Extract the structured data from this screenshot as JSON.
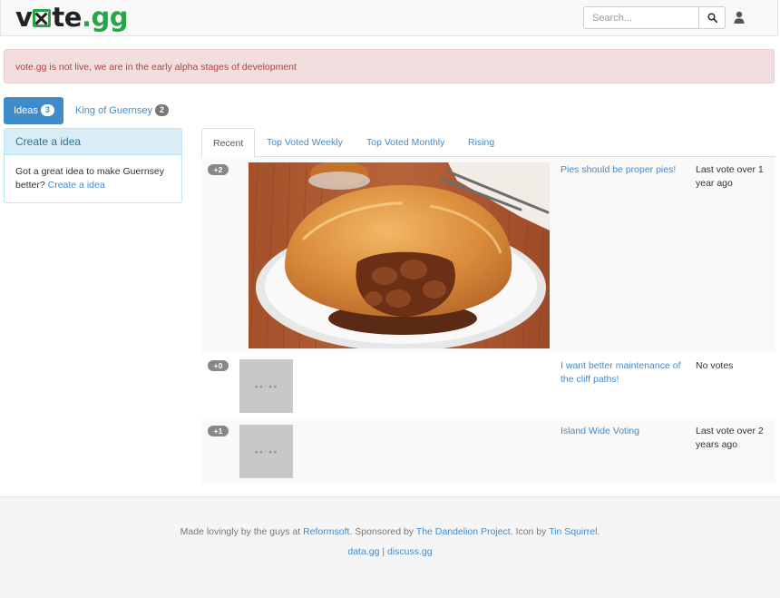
{
  "brand": {
    "part1": "v",
    "part2": "te",
    "dot": ".",
    "part3": "gg"
  },
  "search": {
    "placeholder": "Search..."
  },
  "icons": {
    "search": "search-icon",
    "user": "user-icon"
  },
  "colors": {
    "primary": "#428bca",
    "brand_green": "#2aa44a",
    "alert_bg": "#f2dede",
    "alert_text": "#a94442"
  },
  "alert": {
    "text": "vote.gg is not live, we are in the early alpha stages of development"
  },
  "pills": [
    {
      "label": "Ideas",
      "count": "3",
      "active": true
    },
    {
      "label": "King of Guernsey",
      "count": "2",
      "active": false
    }
  ],
  "panel": {
    "heading": "Create a idea",
    "body": "Got a great idea to make Guernsey better?",
    "link": "Create a idea"
  },
  "tabs": [
    "Recent",
    "Top Voted Weekly",
    "Top Voted Monthly",
    "Rising"
  ],
  "ideas": [
    {
      "votes": "+2",
      "title": "Pies should be proper pies!",
      "last_vote": "Last vote over 1 year ago"
    },
    {
      "votes": "+0",
      "title": "I want better maintenance of the cliff paths!",
      "last_vote": "No votes"
    },
    {
      "votes": "+1",
      "title": "Island Wide Voting",
      "last_vote": "Last vote over 2 years ago"
    }
  ],
  "footer": {
    "made_by": "Made lovingly by the guys at",
    "reformsoft": "Reformsoft",
    "sponsored": ". Sponsored by",
    "dandelion": "The Dandelion Project",
    "icon_by": ". Icon by",
    "tin": "Tin Squirrel",
    "end": ".",
    "data_link": "data.gg",
    "sep": "|",
    "discuss_link": "discuss.gg"
  }
}
